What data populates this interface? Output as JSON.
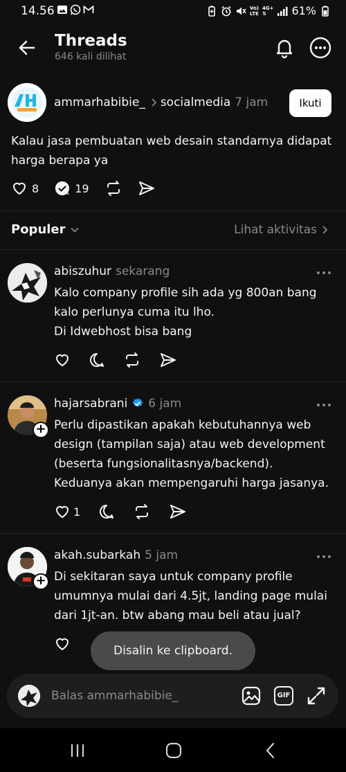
{
  "status": {
    "time": "14.56",
    "battery": "61%",
    "net_label_top": "Vo)",
    "net_label_bottom": "LTE",
    "net_gen": "4G+"
  },
  "header": {
    "title": "Threads",
    "subtitle": "646 kali dilihat"
  },
  "post": {
    "username": "ammarhabibie_",
    "community": "socialmedia",
    "time": "7 jam",
    "follow_label": "Ikuti",
    "text": "Kalau jasa pembuatan web desain standarnya didapat harga berapa ya",
    "likes": "8",
    "replies": "19"
  },
  "sort": {
    "label": "Populer",
    "activity_link": "Lihat aktivitas"
  },
  "replies": [
    {
      "username": "abiszuhur",
      "time": "sekarang",
      "text_lines": [
        "Kalo company profile sih ada yg 800an bang",
        "kalo perlunya cuma itu lho.",
        "Di Idwebhost bisa bang"
      ],
      "likes": "",
      "verified": false
    },
    {
      "username": "hajarsabrani",
      "time": "6 jam",
      "text_lines": [
        "Perlu dipastikan apakah kebutuhannya web",
        "design (tampilan saja) atau web development",
        "(beserta fungsionalitasnya/backend).",
        "Keduanya akan mempengaruhi harga jasanya."
      ],
      "likes": "1",
      "verified": true
    },
    {
      "username": "akah.subarkah",
      "time": "5 jam",
      "text_lines": [
        "Di sekitaran saya untuk company profile",
        "umumnya mulai dari 4.5jt, landing page mulai",
        "dari 1jt-an. btw abang mau beli atau jual?"
      ],
      "likes": "",
      "verified": false
    }
  ],
  "toast": "Disalin ke clipboard.",
  "reply_bar": {
    "placeholder": "Balas ammarhabibie_",
    "gif_label": "GIF"
  },
  "colors": {
    "background": "#101010",
    "text": "#f3f5f7",
    "muted": "#8a8a8a",
    "verified": "#1d9bf0"
  }
}
